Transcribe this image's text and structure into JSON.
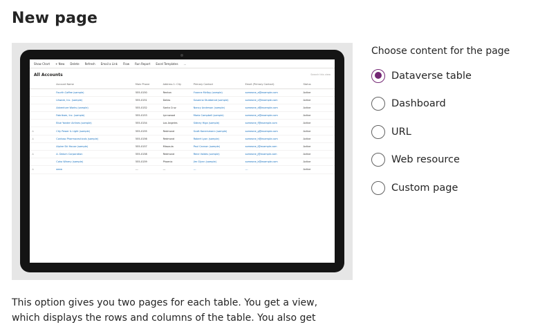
{
  "page": {
    "title": "New page"
  },
  "preview": {
    "commands": [
      "Show Chart",
      "+ New",
      "Delete",
      "Refresh",
      "Email a Link",
      "Flow",
      "Run Report",
      "Excel Templates",
      "..."
    ],
    "view_name": "All Accounts",
    "search_placeholder": "Search this view",
    "columns": [
      "",
      "Account Name",
      "Main Phone",
      "Address 1: City",
      "Primary Contact",
      "Email (Primary Contact)",
      "Status"
    ],
    "rows": [
      [
        "",
        "Fourth Coffee (sample)",
        "555-0150",
        "Renton",
        "Yvonne McKay (sample)",
        "someone_a@example.com",
        "Active"
      ],
      [
        "",
        "Litware, Inc. (sample)",
        "555-0151",
        "Dallas",
        "Susanna Stubberod (sample)",
        "someone_c@example.com",
        "Active"
      ],
      [
        "",
        "Adventure Works (sample)",
        "555-0152",
        "Santa Cruz",
        "Nancy Anderson (sample)",
        "someone_d@example.com",
        "Active"
      ],
      [
        "",
        "Fabrikam, Inc. (sample)",
        "555-0153",
        "Lynnwood",
        "Maria Campbell (sample)",
        "someone_e@example.com",
        "Active"
      ],
      [
        "",
        "Blue Yonder Airlines (sample)",
        "555-0154",
        "Los Angeles",
        "Sidney Higa (sample)",
        "someone_f@example.com",
        "Active"
      ],
      [
        "⚠",
        "City Power & Light (sample)",
        "555-0155",
        "Redmond",
        "Scott Konersmann (sample)",
        "someone_g@example.com",
        "Active"
      ],
      [
        "⚠",
        "Contoso Pharmaceuticals (sample)",
        "555-0156",
        "Redmond",
        "Robert Lyon (sample)",
        "someone_h@example.com",
        "Active"
      ],
      [
        "",
        "Alpine Ski House (sample)",
        "555-0157",
        "Missoula",
        "Paul Cannon (sample)",
        "someone_i@example.com",
        "Active"
      ],
      [
        "⚠",
        "A. Datum Corporation",
        "555-0158",
        "Redmond",
        "Rene Valdes (sample)",
        "someone_j@example.com",
        "Active"
      ],
      [
        "",
        "Coho Winery (sample)",
        "555-0159",
        "Phoenix",
        "Jim Glynn (sample)",
        "someone_k@example.com",
        "Active"
      ],
      [
        "⚠",
        "aaaa",
        "---",
        "---",
        "---",
        "---",
        "Active"
      ]
    ]
  },
  "content": {
    "prompt": "Choose content for the page",
    "options": [
      {
        "label": "Dataverse table",
        "selected": true
      },
      {
        "label": "Dashboard",
        "selected": false
      },
      {
        "label": "URL",
        "selected": false
      },
      {
        "label": "Web resource",
        "selected": false
      },
      {
        "label": "Custom page",
        "selected": false
      }
    ]
  },
  "description": {
    "line1": "This option gives you two pages for each table. You get a view,",
    "line2": "which displays the rows and columns of the table. You also get"
  },
  "colors": {
    "accent": "#742774",
    "link": "#0f6cbd"
  }
}
